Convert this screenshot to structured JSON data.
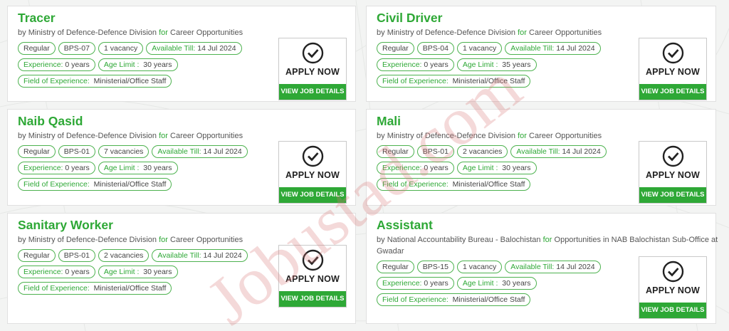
{
  "watermark": "Jobustad.com",
  "labels": {
    "available": "Available Till:",
    "experience": "Experience:",
    "age": "Age Limit :",
    "field": "Field of Experience:",
    "apply": "APPLY NOW",
    "details": "VIEW JOB DETAILS",
    "by": "by",
    "for": "for"
  },
  "jobs": [
    {
      "title": "Tracer",
      "org": "Ministry of Defence-Defence Division",
      "category": "Career Opportunities",
      "type": "Regular",
      "bps": "BPS-07",
      "vacancies": "1 vacancy",
      "available": "14 Jul 2024",
      "experience": "0 years",
      "age": "30 years",
      "field": "Ministerial/Office Staff"
    },
    {
      "title": "Civil Driver",
      "org": "Ministry of Defence-Defence Division",
      "category": "Career Opportunities",
      "type": "Regular",
      "bps": "BPS-04",
      "vacancies": "1 vacancy",
      "available": "14 Jul 2024",
      "experience": "0 years",
      "age": "35 years",
      "field": "Ministerial/Office Staff"
    },
    {
      "title": "Naib Qasid",
      "org": "Ministry of Defence-Defence Division",
      "category": "Career Opportunities",
      "type": "Regular",
      "bps": "BPS-01",
      "vacancies": "7 vacancies",
      "available": "14 Jul 2024",
      "experience": "0 years",
      "age": "30 years",
      "field": "Ministerial/Office Staff"
    },
    {
      "title": "Mali",
      "org": "Ministry of Defence-Defence Division",
      "category": "Career Opportunities",
      "type": "Regular",
      "bps": "BPS-01",
      "vacancies": "2 vacancies",
      "available": "14 Jul 2024",
      "experience": "0 years",
      "age": "30 years",
      "field": "Ministerial/Office Staff"
    },
    {
      "title": "Sanitary Worker",
      "org": "Ministry of Defence-Defence Division",
      "category": "Career Opportunities",
      "type": "Regular",
      "bps": "BPS-01",
      "vacancies": "2 vacancies",
      "available": "14 Jul 2024",
      "experience": "0 years",
      "age": "30 years",
      "field": "Ministerial/Office Staff"
    },
    {
      "title": "Assistant",
      "org": "National Accountability Bureau - Balochistan",
      "category": "Opportunities in NAB Balochistan Sub-Office at Gwadar",
      "type": "Regular",
      "bps": "BPS-15",
      "vacancies": "1 vacancy",
      "available": "14 Jul 2024",
      "experience": "0 years",
      "age": "30 years",
      "field": "Ministerial/Office Staff"
    }
  ],
  "colors": {
    "accent": "#2ea836",
    "border": "#4db24f",
    "watermark": "#d67878"
  }
}
